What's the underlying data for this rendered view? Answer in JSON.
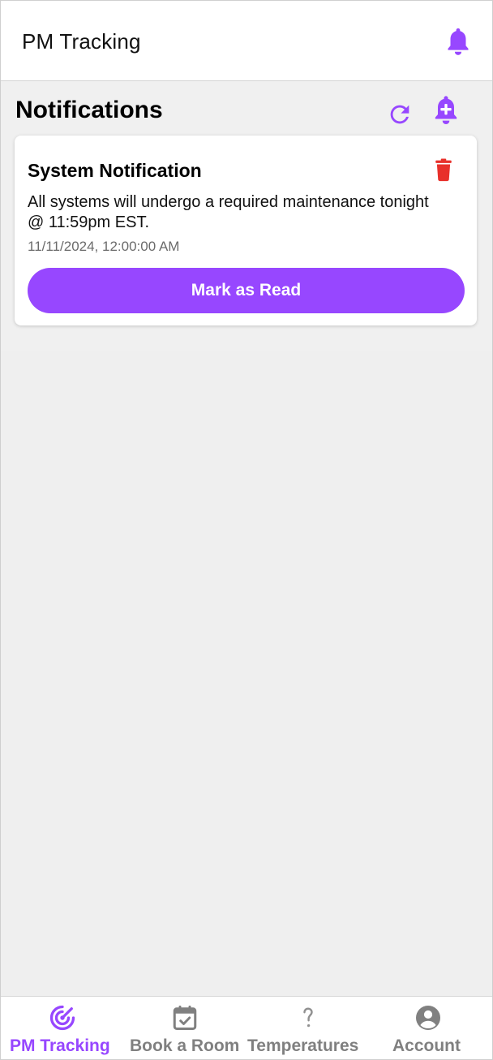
{
  "header": {
    "app_title": "PM Tracking",
    "notification_icon": "bell-icon"
  },
  "page": {
    "title": "Notifications",
    "refresh_icon": "refresh-icon",
    "add_notification_icon": "bell-plus-icon"
  },
  "notifications": [
    {
      "title": "System Notification",
      "body": "All systems will undergo a required maintenance tonight @ 11:59pm EST.",
      "timestamp": "11/11/2024, 12:00:00 AM",
      "action_label": "Mark as Read",
      "delete_icon": "trash-icon"
    }
  ],
  "tabs": [
    {
      "label": "PM Tracking",
      "icon": "target-icon",
      "active": true
    },
    {
      "label": "Book a Room",
      "icon": "calendar-check-icon",
      "active": false
    },
    {
      "label": "Temperatures",
      "icon": "question-icon",
      "active": false
    },
    {
      "label": "Account",
      "icon": "user-circle-icon",
      "active": false
    }
  ],
  "colors": {
    "accent": "#9747ff",
    "danger": "#e8302a",
    "inactive": "#808080",
    "background": "#f0f0f0"
  }
}
